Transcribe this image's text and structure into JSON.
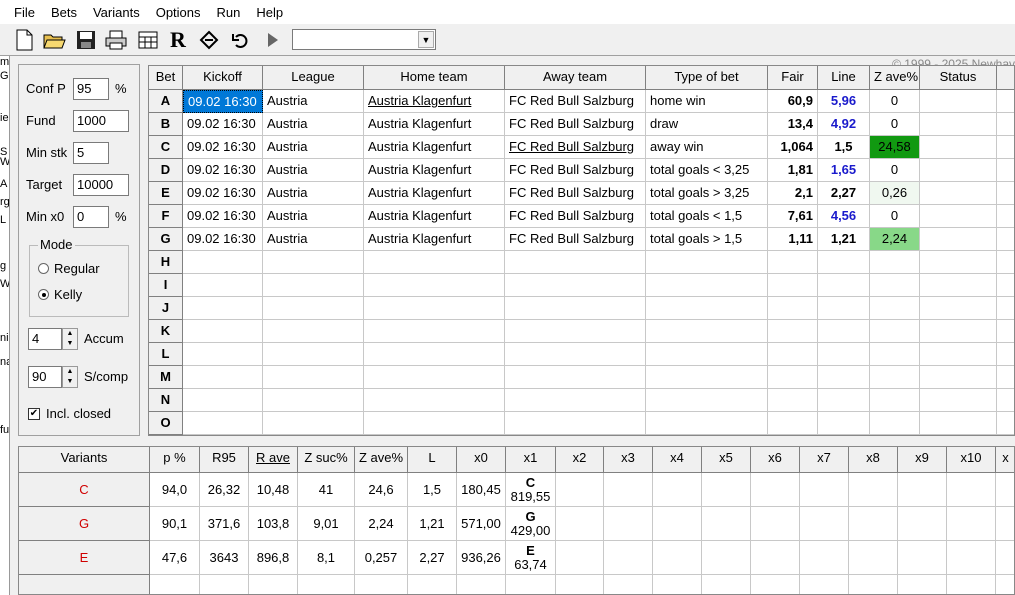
{
  "menu": [
    "File",
    "Bets",
    "Variants",
    "Options",
    "Run",
    "Help"
  ],
  "toolbar": {
    "combo_value": "",
    "copyright": "© 1999 - 2025 Newhav"
  },
  "left_strip": [
    "m",
    "Gr",
    "ie",
    "S",
    "W",
    "A",
    "rg",
    "L",
    "g",
    "W",
    "ni",
    "na",
    "fu"
  ],
  "settings": {
    "conf_p_label": "Conf P",
    "conf_p_value": "95",
    "conf_p_unit": "%",
    "fund_label": "Fund",
    "fund_value": "1000",
    "min_stk_label": "Min stk",
    "min_stk_value": "5",
    "target_label": "Target",
    "target_value": "10000",
    "min_x0_label": "Min x0",
    "min_x0_value": "0",
    "min_x0_unit": "%",
    "mode_label": "Mode",
    "mode_regular": "Regular",
    "mode_kelly": "Kelly",
    "mode_selected": "Kelly",
    "accum_value": "4",
    "accum_label": "Accum",
    "scomp_value": "90",
    "scomp_label": "S/comp",
    "incl_closed_label": "Incl. closed",
    "incl_closed_checked": true
  },
  "bets_table": {
    "columns": [
      "Bet",
      "Kickoff",
      "League",
      "Home team",
      "Away team",
      "Type of bet",
      "Fair",
      "Line",
      "Z ave%",
      "Status"
    ],
    "rows": [
      {
        "bet": "A",
        "kickoff": "09.02 16:30",
        "league": "Austria",
        "home": "Austria Klagenfurt",
        "away": "FC Red Bull Salzburg",
        "type": "home win",
        "fair": "60,9",
        "line": "5,96",
        "zave": "0",
        "status": "",
        "zave_bg": ""
      },
      {
        "bet": "B",
        "kickoff": "09.02 16:30",
        "league": "Austria",
        "home": "Austria Klagenfurt",
        "away": "FC Red Bull Salzburg",
        "type": "draw",
        "fair": "13,4",
        "line": "4,92",
        "zave": "0",
        "status": "",
        "zave_bg": ""
      },
      {
        "bet": "C",
        "kickoff": "09.02 16:30",
        "league": "Austria",
        "home": "Austria Klagenfurt",
        "away": "FC Red Bull Salzburg",
        "type": "away win",
        "fair": "1,064",
        "line": "1,5",
        "zave": "24,58",
        "status": "",
        "zave_bg": "#119911"
      },
      {
        "bet": "D",
        "kickoff": "09.02 16:30",
        "league": "Austria",
        "home": "Austria Klagenfurt",
        "away": "FC Red Bull Salzburg",
        "type": "total goals < 3,25",
        "fair": "1,81",
        "line": "1,65",
        "zave": "0",
        "status": "",
        "zave_bg": ""
      },
      {
        "bet": "E",
        "kickoff": "09.02 16:30",
        "league": "Austria",
        "home": "Austria Klagenfurt",
        "away": "FC Red Bull Salzburg",
        "type": "total goals > 3,25",
        "fair": "2,1",
        "line": "2,27",
        "zave": "0,26",
        "status": "",
        "zave_bg": "#f0f8f0"
      },
      {
        "bet": "F",
        "kickoff": "09.02 16:30",
        "league": "Austria",
        "home": "Austria Klagenfurt",
        "away": "FC Red Bull Salzburg",
        "type": "total goals < 1,5",
        "fair": "7,61",
        "line": "4,56",
        "zave": "0",
        "status": "",
        "zave_bg": ""
      },
      {
        "bet": "G",
        "kickoff": "09.02 16:30",
        "league": "Austria",
        "home": "Austria Klagenfurt",
        "away": "FC Red Bull Salzburg",
        "type": "total goals > 1,5",
        "fair": "1,11",
        "line": "1,21",
        "zave": "2,24",
        "status": "",
        "zave_bg": "#88d888"
      }
    ],
    "empty_rows": [
      "H",
      "I",
      "J",
      "K",
      "L",
      "M",
      "N",
      "O"
    ]
  },
  "variants_table": {
    "columns": [
      "Variants",
      "p %",
      "R95",
      "R ave",
      "Z suc%",
      "Z ave%",
      "L",
      "x0",
      "x1",
      "x2",
      "x3",
      "x4",
      "x5",
      "x6",
      "x7",
      "x8",
      "x9",
      "x10",
      "x"
    ],
    "rows": [
      {
        "variant": "C",
        "p": "94,0",
        "r95": "26,32",
        "rave": "10,48",
        "zsuc": "41",
        "zave": "24,6",
        "l": "1,5",
        "x0": "180,45",
        "x1_top": "C",
        "x1_bottom": "819,55"
      },
      {
        "variant": "G",
        "p": "90,1",
        "r95": "371,6",
        "rave": "103,8",
        "zsuc": "9,01",
        "zave": "2,24",
        "l": "1,21",
        "x0": "571,00",
        "x1_top": "G",
        "x1_bottom": "429,00"
      },
      {
        "variant": "E",
        "p": "47,6",
        "r95": "3643",
        "rave": "896,8",
        "zsuc": "8,1",
        "zave": "0,257",
        "l": "2,27",
        "x0": "936,26",
        "x1_top": "E",
        "x1_bottom": "63,74"
      }
    ]
  }
}
